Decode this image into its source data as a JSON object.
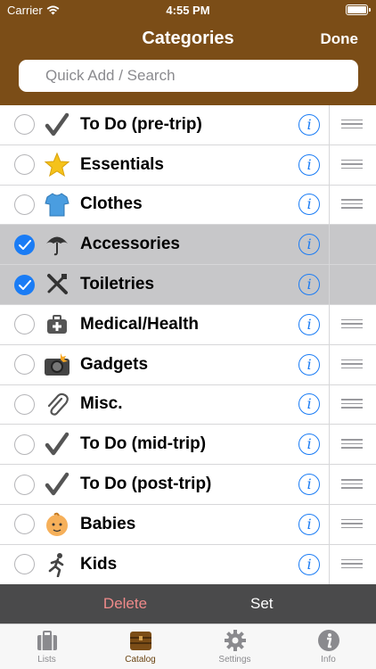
{
  "status_bar": {
    "carrier": "Carrier",
    "time": "4:55 PM"
  },
  "nav": {
    "title": "Categories",
    "done_label": "Done"
  },
  "search": {
    "placeholder": "Quick Add / Search"
  },
  "categories": [
    {
      "label": "To Do (pre-trip)",
      "icon": "checkmark-icon",
      "selected": false
    },
    {
      "label": "Essentials",
      "icon": "star-icon",
      "selected": false
    },
    {
      "label": "Clothes",
      "icon": "shirt-icon",
      "selected": false
    },
    {
      "label": "Accessories",
      "icon": "umbrella-icon",
      "selected": true
    },
    {
      "label": "Toiletries",
      "icon": "toiletries-icon",
      "selected": true
    },
    {
      "label": "Medical/Health",
      "icon": "first-aid-icon",
      "selected": false
    },
    {
      "label": "Gadgets",
      "icon": "camera-icon",
      "selected": false
    },
    {
      "label": "Misc.",
      "icon": "paperclip-icon",
      "selected": false
    },
    {
      "label": "To Do (mid-trip)",
      "icon": "checkmark-icon",
      "selected": false
    },
    {
      "label": "To Do (post-trip)",
      "icon": "checkmark-icon",
      "selected": false
    },
    {
      "label": "Babies",
      "icon": "baby-icon",
      "selected": false
    },
    {
      "label": "Kids",
      "icon": "running-kid-icon",
      "selected": false
    }
  ],
  "actions": {
    "delete_label": "Delete",
    "set_label": "Set"
  },
  "tabs": [
    {
      "label": "Lists",
      "icon": "suitcase-icon",
      "active": false
    },
    {
      "label": "Catalog",
      "icon": "chest-icon",
      "active": true
    },
    {
      "label": "Settings",
      "icon": "gear-icon",
      "active": false
    },
    {
      "label": "Info",
      "icon": "info-icon",
      "active": false
    }
  ],
  "colors": {
    "header": "#7b4d17",
    "accent": "#1a7cf5",
    "selected_row": "#c7c7c9",
    "delete": "#ef8a8a",
    "tab_active": "#6a4412"
  }
}
